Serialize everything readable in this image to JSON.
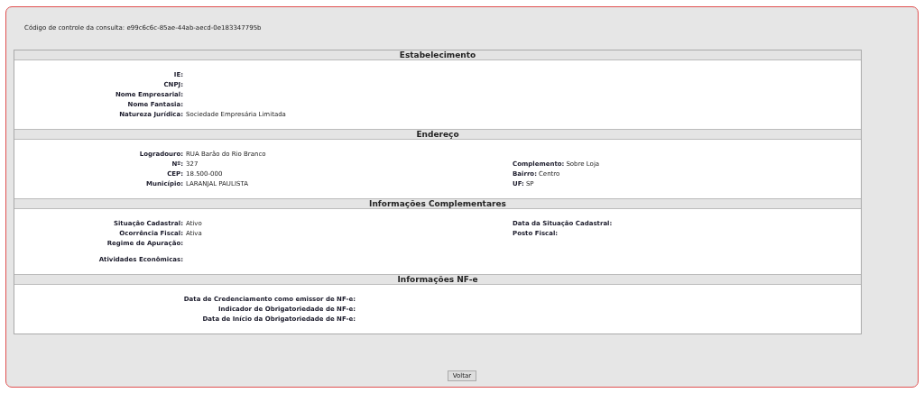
{
  "control_code": {
    "label": "Código de controle da consulta:",
    "value": "e99c6c6c-85ae-44ab-aecd-0e183347795b"
  },
  "sections": [
    {
      "title": "Estabelecimento",
      "kind": "standard",
      "rows": [
        {
          "left": {
            "label": "IE:"
          }
        },
        {
          "left": {
            "label": "CNPJ:"
          }
        },
        {
          "left": {
            "label": "Nome Empresarial:"
          }
        },
        {
          "left": {
            "label": "Nome Fantasia:"
          }
        },
        {
          "left": {
            "label": "Natureza Jurídica:",
            "value": "Sociedade Empresária Limitada"
          }
        }
      ]
    },
    {
      "title": "Endereço",
      "kind": "standard",
      "rows": [
        {
          "left": {
            "label": "Logradouro:",
            "value": "RUA Barão do Rio Branco"
          }
        },
        {
          "left": {
            "label": "Nº:",
            "value": "327"
          },
          "right": {
            "label": "Complemento:",
            "value": "Sobre Loja"
          }
        },
        {
          "left": {
            "label": "CEP:",
            "value": "18.500-000"
          },
          "right": {
            "label": "Bairro:",
            "value": "Centro"
          }
        },
        {
          "left": {
            "label": "Município:",
            "value": "LARANJAL PAULISTA"
          },
          "right": {
            "label": "UF:",
            "value": "SP"
          }
        }
      ]
    },
    {
      "title": "Informações Complementares",
      "kind": "standard",
      "rows": [
        {
          "left": {
            "label": "Situação Cadastral:",
            "value": "Ativo"
          },
          "right": {
            "label": "Data da Situação Cadastral:"
          }
        },
        {
          "left": {
            "label": "Ocorrência Fiscal:",
            "value": "Ativa"
          },
          "right": {
            "label": "Posto Fiscal:"
          }
        },
        {
          "left": {
            "label": "Regime de Apuração:"
          }
        },
        {
          "kind": "spaced",
          "left": {
            "label": "Atividades Econômicas:"
          }
        }
      ]
    },
    {
      "title": "Informações NF-e",
      "kind": "wide",
      "rows": [
        {
          "left": {
            "label": "Data de Credenciamento como emissor de NF-e:"
          }
        },
        {
          "left": {
            "label": "Indicador de Obrigatoriedade de NF-e:"
          }
        },
        {
          "left": {
            "label": "Data de Início da Obrigatoriedade de NF-e:"
          }
        }
      ]
    }
  ],
  "back_button": "Voltar"
}
